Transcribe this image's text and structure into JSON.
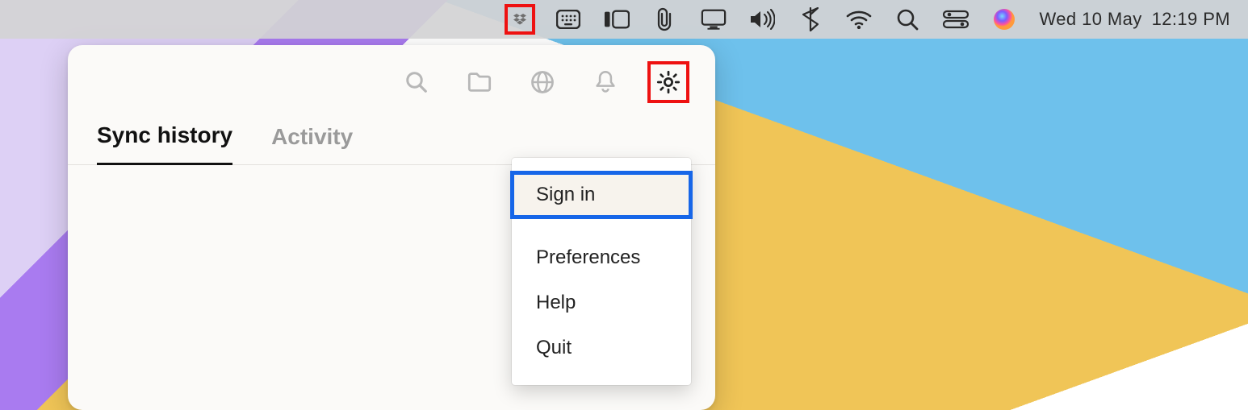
{
  "menubar": {
    "icons": [
      "dropbox",
      "keyboard-viewer",
      "sidecar",
      "paperclip",
      "display",
      "volume",
      "bluetooth",
      "wifi",
      "spotlight",
      "control-center",
      "siri"
    ],
    "date": "Wed 10 May",
    "time": "12:19 PM",
    "highlighted_icon": "dropbox"
  },
  "panel": {
    "toolbar_icons": [
      "search",
      "folder",
      "globe",
      "bell",
      "gear"
    ],
    "highlighted_toolbar_icon": "gear",
    "tabs": [
      {
        "label": "Sync history",
        "active": true
      },
      {
        "label": "Activity",
        "active": false
      }
    ]
  },
  "settings_menu": {
    "items": [
      {
        "label": "Sign in",
        "highlighted": true
      },
      {
        "label": "Preferences"
      },
      {
        "label": "Help"
      },
      {
        "label": "Quit"
      }
    ]
  },
  "highlight_colors": {
    "red": "#e11",
    "blue": "#1766e8"
  }
}
